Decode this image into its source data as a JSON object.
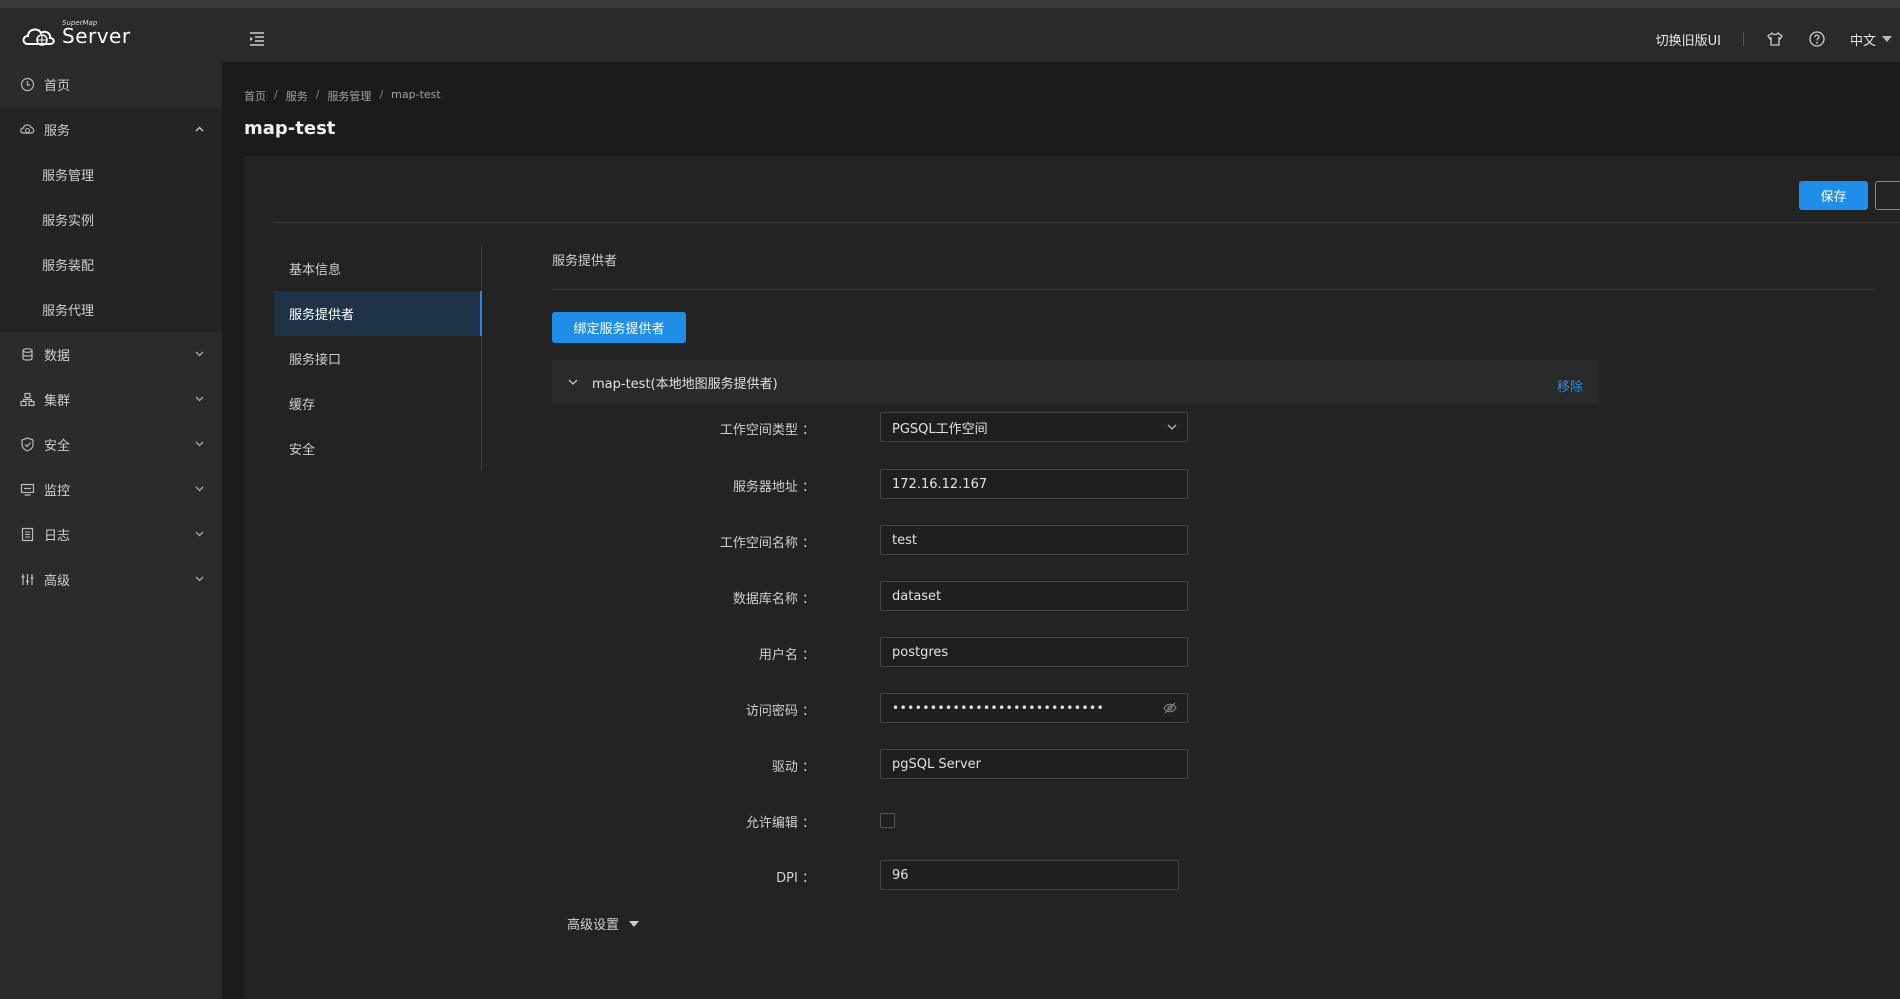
{
  "header": {
    "logo_small": "SuperMap",
    "logo_big": "Server",
    "switch_ui": "切换旧版UI",
    "language": "中文"
  },
  "sidebar": {
    "items": [
      {
        "label": "首页",
        "icon": "home-icon"
      },
      {
        "label": "服务",
        "icon": "service-icon",
        "expanded": true
      },
      {
        "label": "数据",
        "icon": "database-icon"
      },
      {
        "label": "集群",
        "icon": "cluster-icon"
      },
      {
        "label": "安全",
        "icon": "shield-icon"
      },
      {
        "label": "监控",
        "icon": "monitor-icon"
      },
      {
        "label": "日志",
        "icon": "log-icon"
      },
      {
        "label": "高级",
        "icon": "advanced-icon"
      }
    ],
    "service_sub": [
      "服务管理",
      "服务实例",
      "服务装配",
      "服务代理"
    ]
  },
  "breadcrumb": [
    "首页",
    "服务",
    "服务管理",
    "map-test"
  ],
  "page_title": "map-test",
  "actions": {
    "save": "保存"
  },
  "tabs": [
    "基本信息",
    "服务提供者",
    "服务接口",
    "缓存",
    "安全"
  ],
  "active_tab": "服务提供者",
  "provider": {
    "section_title": "服务提供者",
    "bind_button": "绑定服务提供者",
    "panel_title": "map-test(本地地图服务提供者)",
    "remove": "移除",
    "fields": {
      "workspace_type": {
        "label": "工作空间类型 ：",
        "value": "PGSQL工作空间"
      },
      "server_address": {
        "label": "服务器地址 ：",
        "value": "172.16.12.167"
      },
      "workspace_name": {
        "label": "工作空间名称 ：",
        "value": "test"
      },
      "database_name": {
        "label": "数据库名称 ：",
        "value": "dataset"
      },
      "username": {
        "label": "用户名 ：",
        "value": "postgres"
      },
      "password": {
        "label": "访问密码 ：",
        "value": "••••••••••••••••••••••••••••"
      },
      "driver": {
        "label": "驱动 ：",
        "value": "pgSQL Server"
      },
      "allow_edit": {
        "label": "允许编辑 ：",
        "checked": false
      },
      "dpi": {
        "label": "DPI ：",
        "value": "96"
      }
    },
    "advanced": "高级设置"
  },
  "colors": {
    "primary": "#1f8ee8",
    "active_tab_bg": "#1f3347"
  }
}
